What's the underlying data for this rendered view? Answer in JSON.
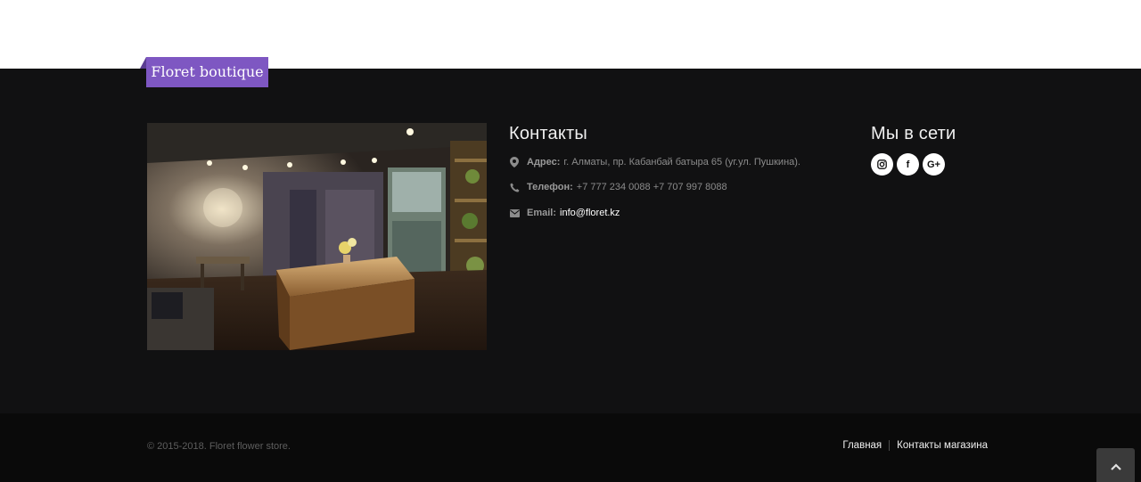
{
  "brand": {
    "name": "Floret boutique",
    "color": "#7e57c2"
  },
  "store_photo": {
    "alt": "store-interior-photo"
  },
  "contacts": {
    "title": "Контакты",
    "address_label": "Адрес:",
    "address_value": "г. Алматы, пр. Кабанбай батыра 65 (уг.ул. Пушкина).",
    "phone_label": "Телефон:",
    "phone_value": "+7 777 234 0088 +7 707 997 8088",
    "email_label": "Email:",
    "email_value": "info@floret.kz",
    "icons": [
      "map-marker-icon",
      "phone-icon",
      "envelope-icon"
    ]
  },
  "social": {
    "title": "Мы в сети",
    "buttons": [
      {
        "icon": "instagram-icon"
      },
      {
        "icon": "facebook-icon",
        "glyph": "f"
      },
      {
        "icon": "google-plus-icon",
        "glyph": "G+"
      }
    ]
  },
  "footer": {
    "copyright": "© 2015-2018. Floret flower store.",
    "nav": [
      "Главная",
      "Контакты магазина"
    ],
    "back_to_top_icon": "chevron-up-icon"
  }
}
